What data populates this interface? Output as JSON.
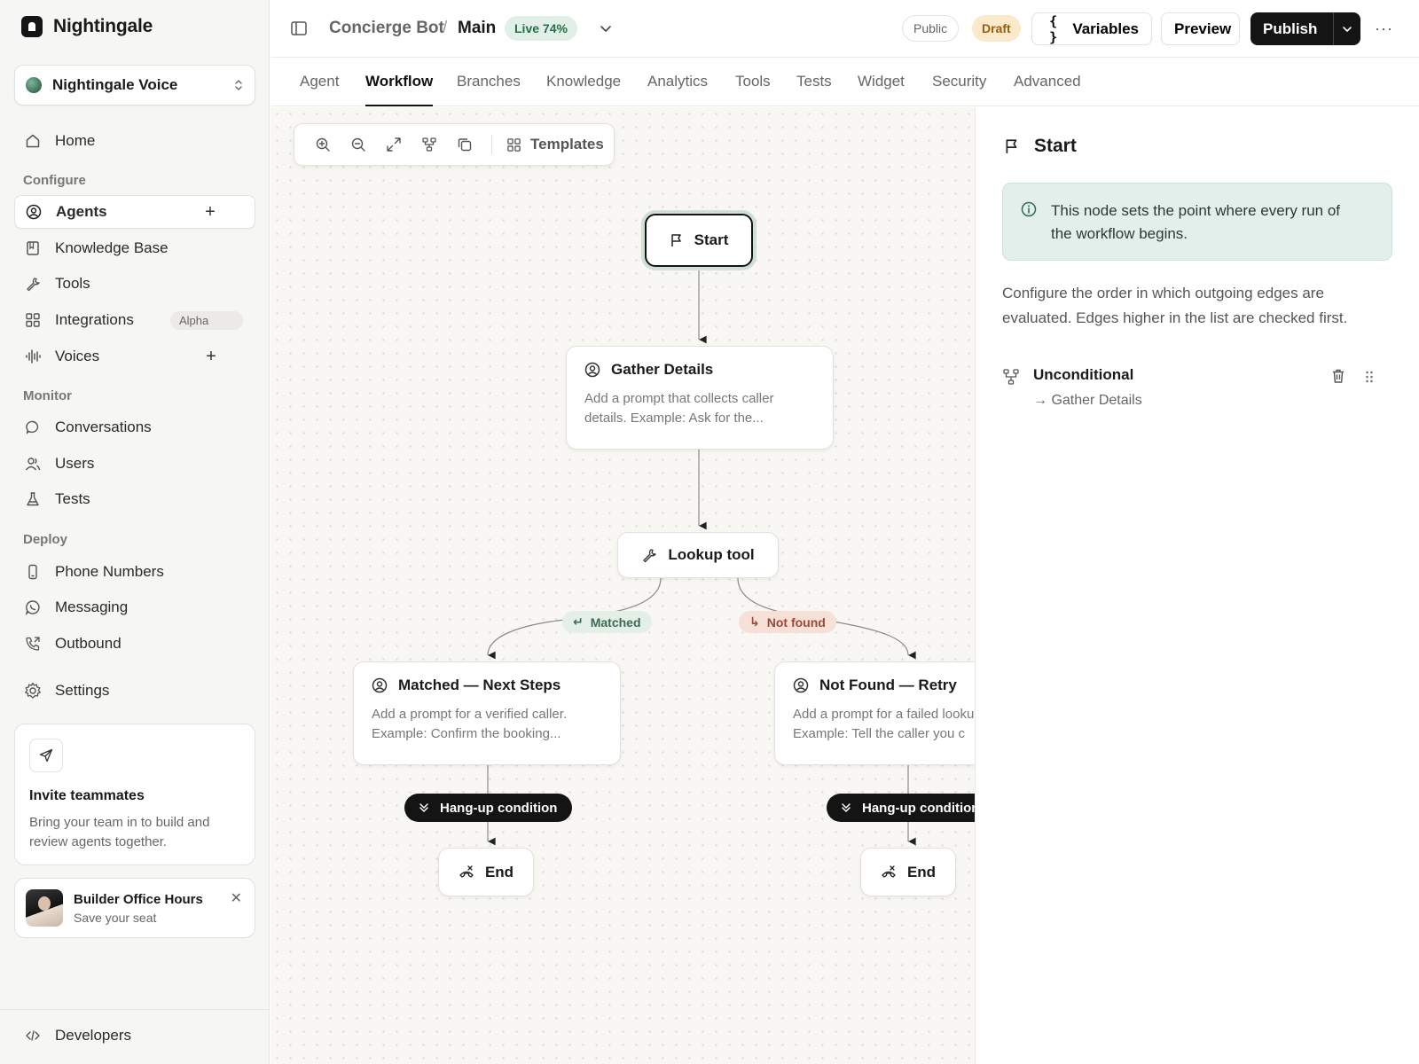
{
  "sidebar": {
    "brand": "Nightingale",
    "workspace": "Nightingale Voice",
    "items": {
      "home": "Home",
      "agents": "Agents",
      "knowledge_base": "Knowledge Base",
      "tools": "Tools",
      "integrations": "Integrations",
      "integrations_badge": "Alpha",
      "voices": "Voices",
      "conversations": "Conversations",
      "users": "Users",
      "tests": "Tests",
      "phone_numbers": "Phone Numbers",
      "messaging": "Messaging",
      "outbound": "Outbound",
      "settings": "Settings",
      "developers": "Developers"
    },
    "sections": {
      "configure": "Configure",
      "monitor": "Monitor",
      "deploy": "Deploy"
    },
    "invite": {
      "title": "Invite teammates",
      "body": "Bring your team in to build and review agents together."
    },
    "promo": {
      "title": "Builder Office Hours",
      "subtitle": "Save your seat"
    }
  },
  "header": {
    "breadcrumb_project": "Concierge Bot",
    "breadcrumb_separator": "/",
    "breadcrumb_branch": "Main",
    "live_badge": "Live 74%",
    "public_badge": "Public",
    "draft_badge": "Draft",
    "variables_label": "Variables",
    "preview_label": "Preview",
    "publish_label": "Publish"
  },
  "tabs": [
    "Agent",
    "Workflow",
    "Branches",
    "Knowledge",
    "Analytics",
    "Tools",
    "Tests",
    "Widget",
    "Security",
    "Advanced"
  ],
  "active_tab": "Workflow",
  "toolbar": {
    "templates_label": "Templates"
  },
  "workflow": {
    "start": "Start",
    "gather": {
      "title": "Gather Details",
      "desc_1": "Add a prompt that collects caller",
      "desc_2": "details. Example: Ask for the..."
    },
    "lookup": "Lookup tool",
    "edge_matched": "Matched",
    "edge_not_found": "Not found",
    "matched": {
      "title": "Matched — Next Steps",
      "desc_1": "Add a prompt for a verified caller.",
      "desc_2": "Example: Confirm the booking..."
    },
    "not_found": {
      "title": "Not Found — Retry",
      "desc_1": "Add a prompt for a failed lookup.",
      "desc_2": "Example: Tell the caller you c"
    },
    "hangup_label": "Hang-up condition",
    "end_label": "End"
  },
  "panel": {
    "title": "Start",
    "info_1": "This node sets the point where every run of",
    "info_2": "the workflow begins.",
    "description": "Configure the order in which outgoing edges are evaluated. Edges higher in the list are checked first.",
    "edge_title": "Unconditional",
    "edge_target": "Gather Details",
    "edge_arrow": "→"
  },
  "colors": {
    "accent_dark": "#141414",
    "live_green": "#24704a",
    "draft_amber": "#9a5e10",
    "info_bg": "#e3efea"
  }
}
